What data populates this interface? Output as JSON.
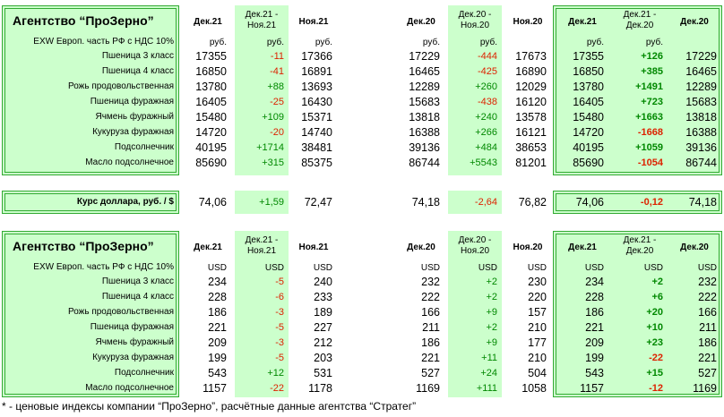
{
  "columns": {
    "dec21": "Дек.21",
    "mom_l1": "Дек.21 -",
    "mom_l2": "Ноя.21",
    "nov21": "Ноя.21",
    "dec20": "Дек.20",
    "prev_mom_l1": "Дек.20 -",
    "prev_mom_l2": "Ноя.20",
    "nov20": "Ноя.20",
    "yoy_l1": "Дек.21 -",
    "yoy_l2": "Дек.20"
  },
  "rub_block": {
    "title": "Агентство “ПроЗерно”",
    "subtitle": "EXW Европ. часть РФ с НДС 10%",
    "unit": "руб.",
    "rows": [
      {
        "name": "Пшеница 3 класс",
        "dec21": "17355",
        "mom": "-11",
        "nov21": "17366",
        "dec20": "17229",
        "pmom": "-444",
        "nov20": "17673",
        "yoy": "+126"
      },
      {
        "name": "Пшеница 4 класс",
        "dec21": "16850",
        "mom": "-41",
        "nov21": "16891",
        "dec20": "16465",
        "pmom": "-425",
        "nov20": "16890",
        "yoy": "+385"
      },
      {
        "name": "Рожь продовольственная",
        "dec21": "13780",
        "mom": "+88",
        "nov21": "13693",
        "dec20": "12289",
        "pmom": "+260",
        "nov20": "12029",
        "yoy": "+1491"
      },
      {
        "name": "Пшеница фуражная",
        "dec21": "16405",
        "mom": "-25",
        "nov21": "16430",
        "dec20": "15683",
        "pmom": "-438",
        "nov20": "16120",
        "yoy": "+723"
      },
      {
        "name": "Ячмень фуражный",
        "dec21": "15480",
        "mom": "+109",
        "nov21": "15371",
        "dec20": "13818",
        "pmom": "+240",
        "nov20": "13578",
        "yoy": "+1663"
      },
      {
        "name": "Кукуруза фуражная",
        "dec21": "14720",
        "mom": "-20",
        "nov21": "14740",
        "dec20": "16388",
        "pmom": "+266",
        "nov20": "16121",
        "yoy": "-1668"
      },
      {
        "name": "Подсолнечник",
        "dec21": "40195",
        "mom": "+1714",
        "nov21": "38481",
        "dec20": "39136",
        "pmom": "+484",
        "nov20": "38653",
        "yoy": "+1059"
      },
      {
        "name": "Масло подсолнечное",
        "dec21": "85690",
        "mom": "+315",
        "nov21": "85375",
        "dec20": "86744",
        "pmom": "+5543",
        "nov20": "81201",
        "yoy": "-1054"
      }
    ]
  },
  "fx": {
    "label": "Курс доллара, руб.  / $",
    "dec21": "74,06",
    "mom": "+1,59",
    "nov21": "72,47",
    "dec20": "74,18",
    "pmom": "-2,64",
    "nov20": "76,82",
    "yoy": "-0,12"
  },
  "usd_block": {
    "title": "Агентство “ПроЗерно”",
    "subtitle": "EXW Европ. часть РФ с НДС 10%",
    "unit": "USD",
    "rows": [
      {
        "name": "Пшеница 3 класс",
        "dec21": "234",
        "mom": "-5",
        "nov21": "240",
        "dec20": "232",
        "pmom": "+2",
        "nov20": "230",
        "yoy": "+2"
      },
      {
        "name": "Пшеница 4 класс",
        "dec21": "228",
        "mom": "-6",
        "nov21": "233",
        "dec20": "222",
        "pmom": "+2",
        "nov20": "220",
        "yoy": "+6"
      },
      {
        "name": "Рожь продовольственная",
        "dec21": "186",
        "mom": "-3",
        "nov21": "189",
        "dec20": "166",
        "pmom": "+9",
        "nov20": "157",
        "yoy": "+20"
      },
      {
        "name": "Пшеница фуражная",
        "dec21": "221",
        "mom": "-5",
        "nov21": "227",
        "dec20": "211",
        "pmom": "+2",
        "nov20": "210",
        "yoy": "+10"
      },
      {
        "name": "Ячмень фуражный",
        "dec21": "209",
        "mom": "-3",
        "nov21": "212",
        "dec20": "186",
        "pmom": "+9",
        "nov20": "177",
        "yoy": "+23"
      },
      {
        "name": "Кукуруза фуражная",
        "dec21": "199",
        "mom": "-5",
        "nov21": "203",
        "dec20": "221",
        "pmom": "+11",
        "nov20": "210",
        "yoy": "-22"
      },
      {
        "name": "Подсолнечник",
        "dec21": "543",
        "mom": "+12",
        "nov21": "531",
        "dec20": "527",
        "pmom": "+24",
        "nov20": "504",
        "yoy": "+15"
      },
      {
        "name": "Масло подсолнечное",
        "dec21": "1157",
        "mom": "-22",
        "nov21": "1178",
        "dec20": "1169",
        "pmom": "+111",
        "nov20": "1058",
        "yoy": "-12"
      }
    ]
  },
  "footnote": "* - ценовые индексы компании “ПроЗерно”, расчётные данные агентства “Стратег”",
  "colors": {
    "green_bg": "#ccffcc",
    "border": "#33aa33",
    "positive": "#008800",
    "negative": "#dd2200"
  }
}
